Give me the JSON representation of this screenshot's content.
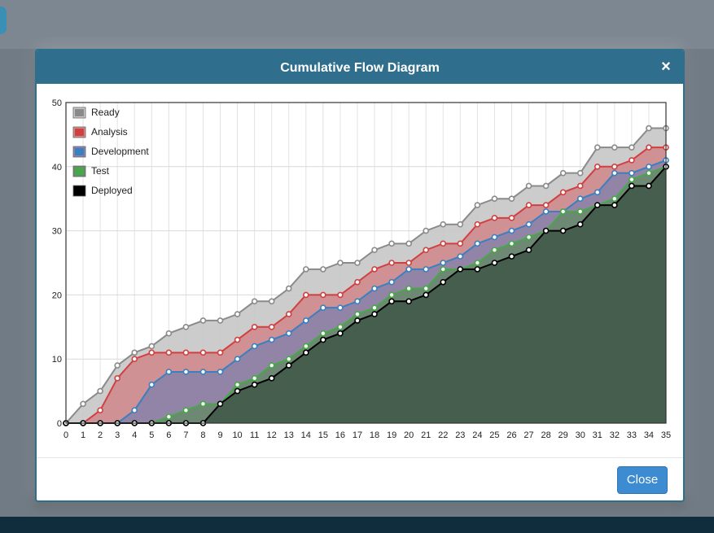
{
  "modal": {
    "title": "Cumulative Flow Diagram",
    "close_icon": "×",
    "close_button": "Close"
  },
  "chart_data": {
    "type": "area",
    "title": "",
    "xlabel": "",
    "ylabel": "",
    "xlim": [
      0,
      35
    ],
    "ylim": [
      0,
      50
    ],
    "yticks": [
      0,
      10,
      20,
      30,
      40,
      50
    ],
    "grid": true,
    "legend_position": "top-left",
    "x": [
      0,
      1,
      2,
      3,
      4,
      5,
      6,
      7,
      8,
      9,
      10,
      11,
      12,
      13,
      14,
      15,
      16,
      17,
      18,
      19,
      20,
      21,
      22,
      23,
      24,
      25,
      26,
      27,
      28,
      29,
      30,
      31,
      32,
      33,
      34,
      35
    ],
    "series": [
      {
        "name": "Ready",
        "color": "#8a8a8a",
        "fill": "#c8c8c8",
        "values": [
          0,
          3,
          5,
          9,
          11,
          12,
          14,
          15,
          16,
          16,
          17,
          19,
          19,
          21,
          24,
          24,
          25,
          25,
          27,
          28,
          28,
          30,
          31,
          31,
          34,
          35,
          35,
          37,
          37,
          39,
          39,
          43,
          43,
          43,
          46,
          46
        ]
      },
      {
        "name": "Analysis",
        "color": "#d04040",
        "fill": "#cf8c8e",
        "values": [
          0,
          0,
          2,
          7,
          10,
          11,
          11,
          11,
          11,
          11,
          13,
          15,
          15,
          17,
          20,
          20,
          20,
          22,
          24,
          25,
          25,
          27,
          28,
          28,
          31,
          32,
          32,
          34,
          34,
          36,
          37,
          40,
          40,
          41,
          43,
          43
        ]
      },
      {
        "name": "Development",
        "color": "#3a7fc0",
        "fill": "#8d83a8",
        "values": [
          0,
          0,
          0,
          0,
          2,
          6,
          8,
          8,
          8,
          8,
          10,
          12,
          13,
          14,
          16,
          18,
          18,
          19,
          21,
          22,
          24,
          24,
          25,
          26,
          28,
          29,
          30,
          31,
          33,
          33,
          35,
          36,
          39,
          39,
          40,
          41
        ]
      },
      {
        "name": "Test",
        "color": "#46a846",
        "fill": "#6a8a6f",
        "values": [
          0,
          0,
          0,
          0,
          0,
          0,
          1,
          2,
          3,
          3,
          6,
          7,
          9,
          10,
          12,
          14,
          15,
          17,
          18,
          20,
          21,
          21,
          24,
          24,
          25,
          27,
          28,
          29,
          30,
          33,
          33,
          34,
          35,
          38,
          39,
          40
        ]
      },
      {
        "name": "Deployed",
        "color": "#000000",
        "fill": "#435a4a",
        "values": [
          0,
          0,
          0,
          0,
          0,
          0,
          0,
          0,
          0,
          3,
          5,
          6,
          7,
          9,
          11,
          13,
          14,
          16,
          17,
          19,
          19,
          20,
          22,
          24,
          24,
          25,
          26,
          27,
          30,
          30,
          31,
          34,
          34,
          37,
          37,
          40
        ]
      }
    ]
  }
}
